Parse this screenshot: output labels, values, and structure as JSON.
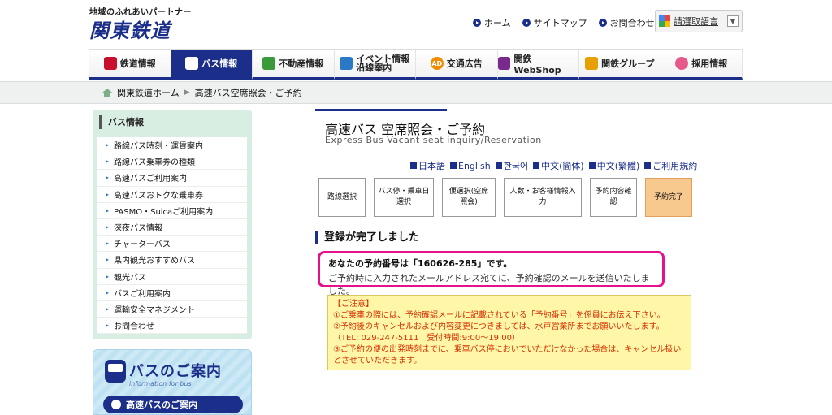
{
  "header": {
    "tagline": "地域のふれあいパートナー",
    "logo": "関東鉄道",
    "links": [
      "ホーム",
      "サイトマップ",
      "お問合わせ"
    ],
    "lang_select_label": "請選取語言"
  },
  "nav": [
    {
      "label": "鉄道情報",
      "icon": "train-icon"
    },
    {
      "label": "バス情報",
      "icon": "bus-icon"
    },
    {
      "label": "不動産情報",
      "icon": "building-icon"
    },
    {
      "label": "イベント情報",
      "label2": "沿線案内",
      "icon": "event-icon"
    },
    {
      "label": "交通広告",
      "icon": "ad-icon"
    },
    {
      "label": "関鉄WebShop",
      "icon": "cart-icon"
    },
    {
      "label": "関鉄グループ",
      "icon": "group-icon"
    },
    {
      "label": "採用情報",
      "icon": "people-icon"
    }
  ],
  "breadcrumb": [
    "関東鉄道ホーム",
    "高速バス空席照会・ご予約"
  ],
  "sidebar": {
    "title": "バス情報",
    "items": [
      "路線バス時刻・運賃案内",
      "路線バス乗車券の種類",
      "高速バスご利用案内",
      "高速バスおトクな乗車券",
      "PASMO・Suicaご利用案内",
      "深夜バス情報",
      "チャーターバス",
      "県内観光おすすめバス",
      "観光バス",
      "バスご利用案内",
      "運輸安全マネジメント",
      "お問合わせ"
    ]
  },
  "banner": {
    "title": "バスのご案内",
    "subtitle": "information for bus",
    "button": "高速バスのご案内"
  },
  "page": {
    "title": "高速バス  空席照会・ご予約",
    "subtitle": "Express Bus  Vacant seat inquiry/Reservation"
  },
  "languages": [
    "日本語",
    "English",
    "한국어",
    "中文(簡体)",
    "中文(繁體)",
    "ご利用規約"
  ],
  "steps": [
    {
      "label": "路線選択",
      "done": false
    },
    {
      "label": "バス停・乗車日選択",
      "done": false
    },
    {
      "label": "便選択(空席照会)",
      "done": false
    },
    {
      "label": "人数・お客様情報入力",
      "done": false
    },
    {
      "label": "予約内容確認",
      "done": false
    },
    {
      "label": "予約完了",
      "done": true
    }
  ],
  "result": {
    "heading": "登録が完了しました",
    "line1_prefix": "あなたの予約番号は「",
    "reservation_number": "160626-285",
    "line1_suffix": "」です。",
    "line2": "ご予約時に入力されたメールアドレス宛てに、予約確認のメールを送信いたしました。"
  },
  "notice": {
    "title": "【ご注意】",
    "lines": [
      "①ご乗車の際には、予約確認メールに記載されている「予約番号」を係員にお伝え下さい。",
      "②予約後のキャンセルおよび内容変更につきましては、水戸営業所までお願いいたします。",
      "（TEL: 029-247-5111　受付時間:9:00～19:00）",
      "③ご予約の便の出発時刻までに、乗車バス停においでいただけなかった場合は、キャンセル扱いとさせていただきます。"
    ]
  },
  "colors": {
    "brand": "#1a2e8a",
    "highlight": "#e5128c",
    "step_done": "#f8c98f",
    "notice_bg": "#fff6a8",
    "notice_text": "#d63000"
  }
}
